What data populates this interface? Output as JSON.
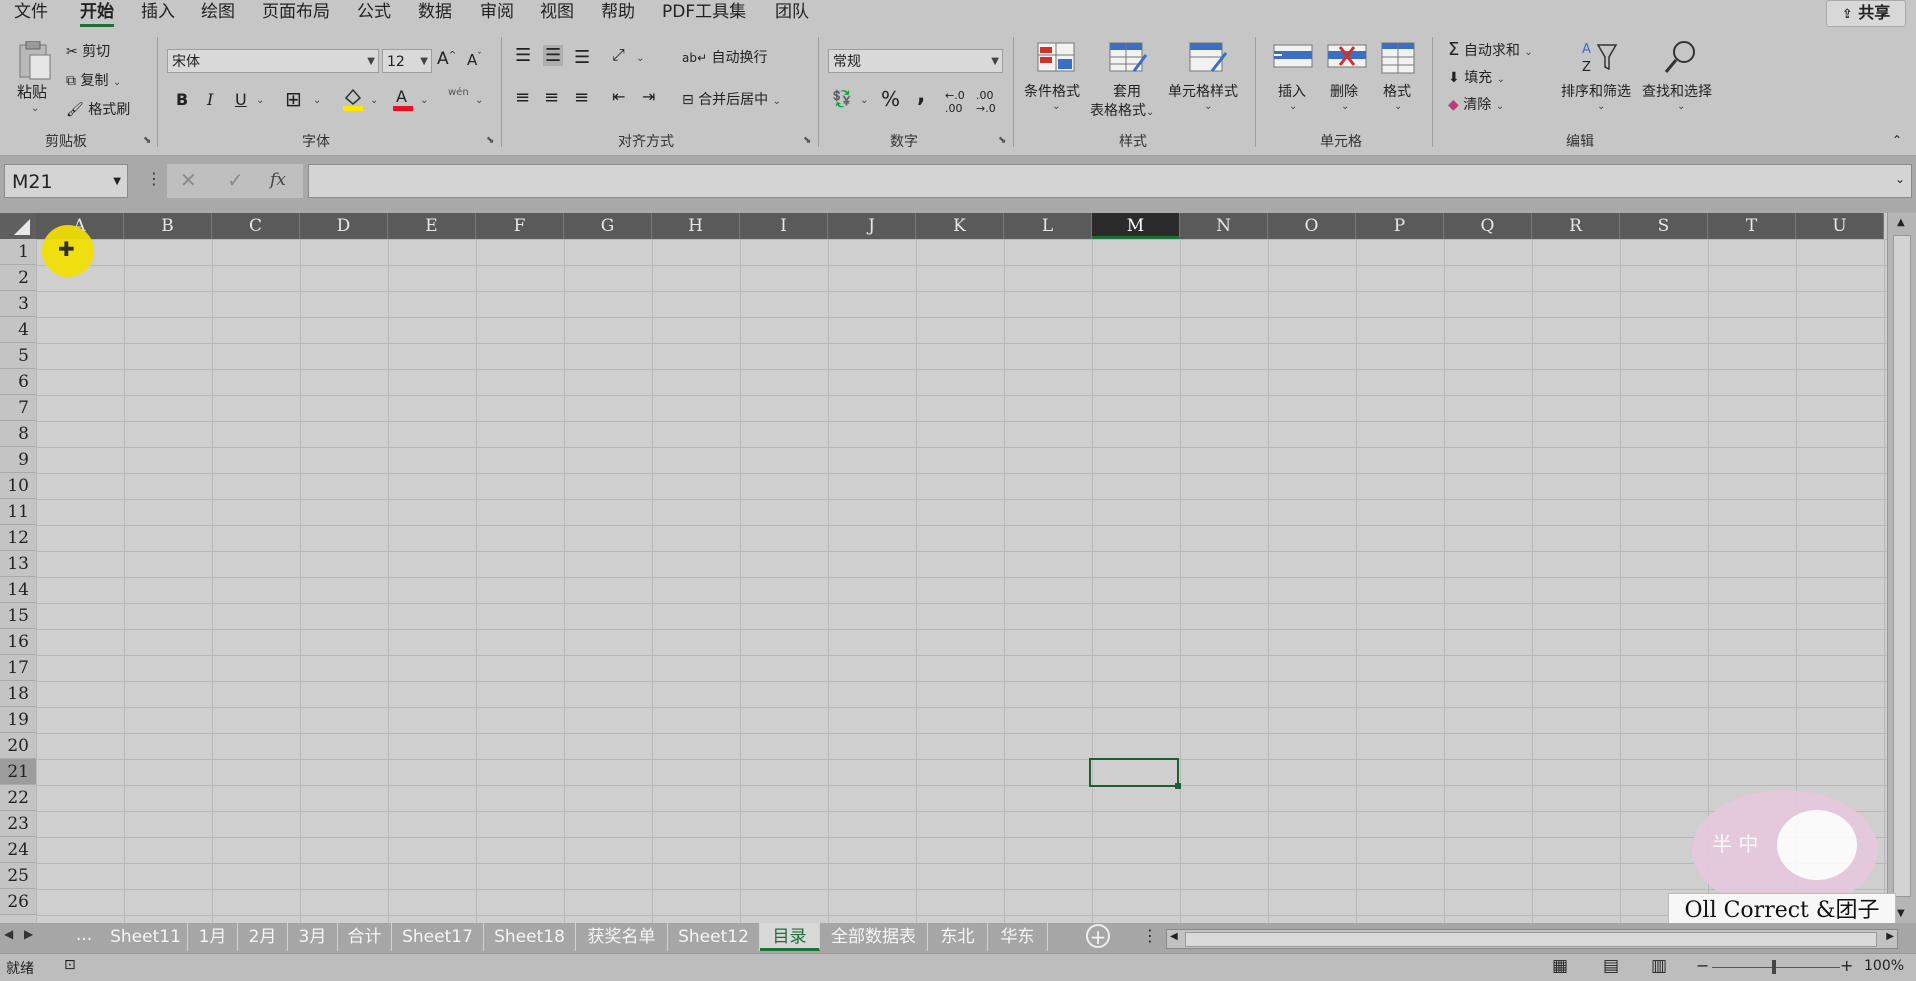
{
  "menu": {
    "items": [
      "文件",
      "开始",
      "插入",
      "绘图",
      "页面布局",
      "公式",
      "数据",
      "审阅",
      "视图",
      "帮助",
      "PDF工具集",
      "团队"
    ],
    "active_index": 1,
    "share_label": "共享"
  },
  "ribbon": {
    "clipboard": {
      "paste": "粘贴",
      "cut": "剪切",
      "copy": "复制",
      "format_painter": "格式刷",
      "group_label": "剪贴板"
    },
    "font": {
      "font_name": "宋体",
      "font_size": "12",
      "bold": "B",
      "italic": "I",
      "underline": "U",
      "phonetic": "wén",
      "group_label": "字体"
    },
    "alignment": {
      "wrap_text": "自动换行",
      "merge_center": "合并后居中",
      "group_label": "对齐方式"
    },
    "number": {
      "format": "常规",
      "percent": "%",
      "comma": ",",
      "group_label": "数字"
    },
    "styles": {
      "conditional": "条件格式",
      "table_format_line1": "套用",
      "table_format_line2": "表格格式",
      "cell_styles": "单元格样式",
      "group_label": "样式"
    },
    "cells": {
      "insert": "插入",
      "delete": "删除",
      "format": "格式",
      "group_label": "单元格"
    },
    "editing": {
      "autosum": "自动求和",
      "fill": "填充",
      "clear": "清除",
      "sort_filter": "排序和筛选",
      "find_select": "查找和选择",
      "group_label": "编辑"
    }
  },
  "formula_bar": {
    "name_box": "M21",
    "fx": "fx",
    "formula": ""
  },
  "grid": {
    "columns": [
      "A",
      "B",
      "C",
      "D",
      "E",
      "F",
      "G",
      "H",
      "I",
      "J",
      "K",
      "L",
      "M",
      "N",
      "O",
      "P",
      "Q",
      "R",
      "S",
      "T",
      "U"
    ],
    "rows": [
      "1",
      "2",
      "3",
      "4",
      "5",
      "6",
      "7",
      "8",
      "9",
      "10",
      "11",
      "12",
      "13",
      "14",
      "15",
      "16",
      "17",
      "18",
      "19",
      "20",
      "21",
      "22",
      "23",
      "24",
      "25",
      "26"
    ],
    "selected_column": "M",
    "selected_row": "21"
  },
  "sheets": {
    "ellipsis": "...",
    "tabs": [
      "Sheet11",
      "1月",
      "2月",
      "3月",
      "合计",
      "Sheet17",
      "Sheet18",
      "获奖名单",
      "Sheet12",
      "目录",
      "全部数据表",
      "东北",
      "华东"
    ],
    "active": "目录"
  },
  "status": {
    "ready": "就绪",
    "zoom": "100%"
  },
  "watermark": {
    "text": "Oll Correct &团子"
  },
  "colors": {
    "accent": "#1e6e3a",
    "cursor_highlight": "#f2e000"
  }
}
